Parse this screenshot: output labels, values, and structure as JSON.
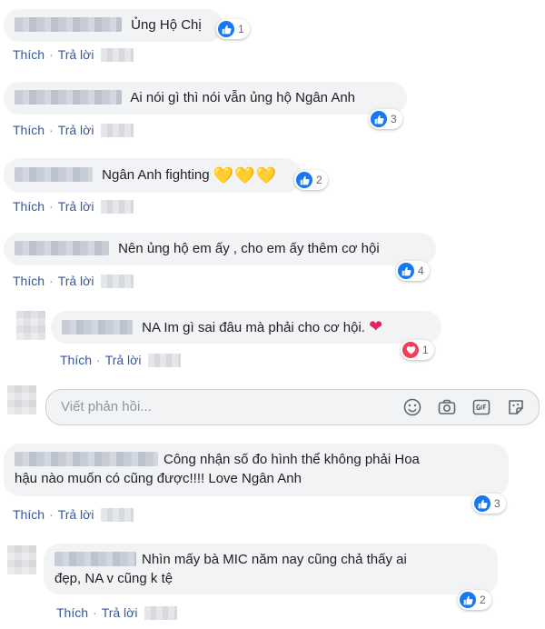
{
  "actions": {
    "like": "Thích",
    "reply": "Trả lời",
    "sep": "·"
  },
  "comments": [
    {
      "text": "Ủng Hộ Chị",
      "reaction": "like",
      "count": "1"
    },
    {
      "text": "Ai nói gì thì nói vẫn ủng hộ Ngân Anh",
      "reaction": "like",
      "count": "3"
    },
    {
      "text": "Ngân Anh fighting",
      "emoji": "💛💛💛",
      "reaction": "like",
      "count": "2"
    },
    {
      "text": "Nên ủng hộ em ấy , cho em ấy thêm cơ hội",
      "reaction": "like",
      "count": "4"
    },
    {
      "text": "NA Im gì sai đâu mà phải cho cơ hội.",
      "emoji": "❤",
      "reaction": "love",
      "count": "1"
    },
    {
      "text_line1": "Công nhận số đo hình thể không phải Hoa",
      "text_line2": "hậu nào muốn có cũng được!!!! Love Ngân Anh",
      "reaction": "like",
      "count": "3"
    },
    {
      "text_line1": "Nhìn mấy bà MIC năm nay cũng chả thấy ai",
      "text_line2": "đẹp, NA v cũng k tệ",
      "reaction": "like",
      "count": "2"
    }
  ],
  "reply_box": {
    "placeholder": "Viết phản hồi...",
    "icons": [
      "emoji-icon",
      "camera-icon",
      "gif-icon",
      "sticker-icon"
    ]
  },
  "colors": {
    "link": "#385898",
    "bubble": "#f2f3f5",
    "like": "#1877f2",
    "love": "#f33e58"
  }
}
